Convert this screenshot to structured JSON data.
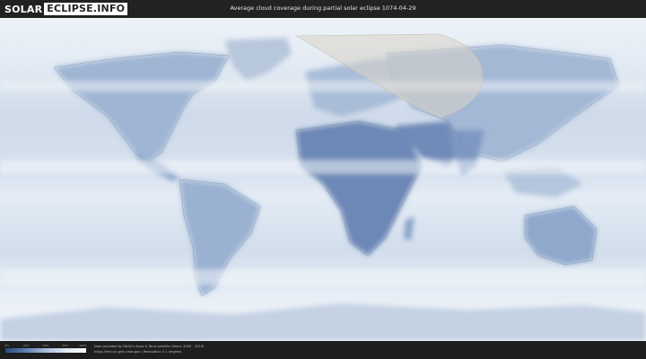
{
  "header": {
    "logo_part1": "SOLAR",
    "logo_part2": "ECLIPSE.INFO",
    "title": "Average cloud coverage during partial solar eclipse 1074-04-29"
  },
  "map": {
    "colors": {
      "clear": "#2f4f85",
      "cloud": "#ffffff",
      "eclipse_zone": "#d8d4c8"
    }
  },
  "legend": {
    "ticks": [
      "0%",
      "25%",
      "50%",
      "75%",
      "100%"
    ]
  },
  "credits": {
    "line1": "Data provided by NASA's Aqua & Terra satellite (Years: 2000 - 2019)",
    "line2": "https://neo.sci.gsfc.nasa.gov  |  Resolution: 0.1 degrees"
  }
}
